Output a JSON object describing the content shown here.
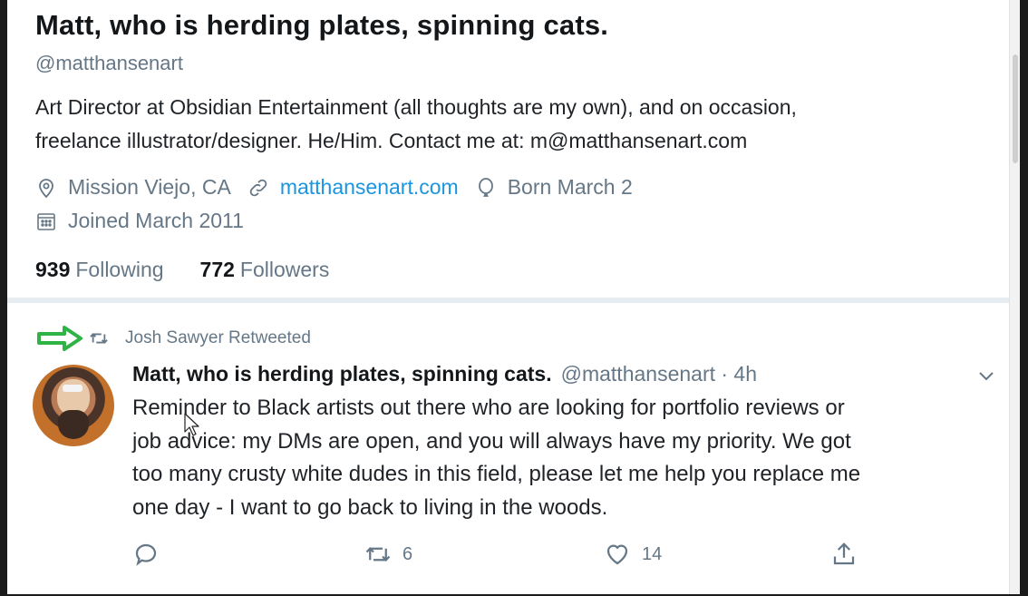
{
  "profile": {
    "name": "Matt, who is herding plates, spinning cats.",
    "handle": "@matthansenart",
    "bio_line1": "Art Director at Obsidian Entertainment (all thoughts are my own), and on occasion,",
    "bio_line2": "freelance illustrator/designer. He/Him. Contact me at: m@matthansenart.com",
    "location": "Mission Viejo, CA",
    "website": "matthansenart.com",
    "born": "Born March 2",
    "joined": "Joined March 2011",
    "following_count": "939",
    "following_label": "Following",
    "followers_count": "772",
    "followers_label": "Followers"
  },
  "tweet": {
    "retweeted_by": "Josh Sawyer Retweeted",
    "author_name": "Matt, who is herding plates, spinning cats.",
    "author_handle_time": "@matthansenart · 4h",
    "text_line1": "Reminder to Black artists out there who are looking for portfolio reviews or",
    "text_line2": "job advice: my DMs are open, and you will always have my priority. We got",
    "text_line3": "too many crusty white dudes in this field, please let me help you replace me",
    "text_line4": "one day - I want to go back to living in the woods.",
    "reply_count": "",
    "retweet_count": "6",
    "like_count": "14"
  },
  "colors": {
    "accent": "#1b95e0",
    "muted": "#657786",
    "annotation_arrow": "#2fb344"
  },
  "icons": {
    "location": "location-pin-icon",
    "link": "link-icon",
    "born": "balloon-icon",
    "joined": "calendar-icon",
    "retweet": "retweet-icon",
    "reply": "reply-icon",
    "like": "heart-icon",
    "share": "share-icon",
    "more": "chevron-down-icon"
  }
}
